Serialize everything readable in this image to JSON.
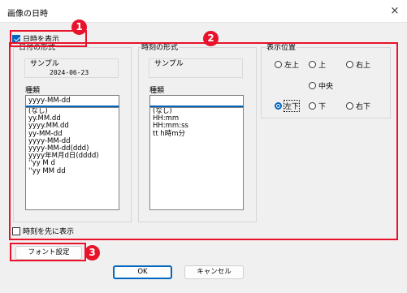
{
  "window": {
    "title": "画像の日時",
    "close_icon": "×"
  },
  "show_datetime": {
    "label": "日時を表示",
    "checked": true
  },
  "date_format": {
    "group_label": "日付の形式",
    "sample_label": "サンプル",
    "sample_value": "2024-06-23",
    "kind_label": "種類",
    "input_value": "yyyy-MM-dd",
    "options": [
      "(なし)",
      "yy.MM.dd",
      "yyyy.MM.dd",
      "yy-MM-dd",
      "yyyy-MM-dd",
      "yyyy-MM-dd(ddd)",
      "yyyy年M月d日(dddd)",
      "''yy M d",
      "''yy MM dd"
    ]
  },
  "time_format": {
    "group_label": "時刻の形式",
    "sample_label": "サンプル",
    "sample_value": "",
    "kind_label": "種類",
    "input_value": "",
    "options": [
      "(なし)",
      "HH:mm",
      "HH:mm:ss",
      "tt h時m分"
    ]
  },
  "position": {
    "group_label": "表示位置",
    "options": [
      "左上",
      "上",
      "右上",
      "中央",
      "左下",
      "下",
      "右下"
    ],
    "selected": "左下"
  },
  "time_first": {
    "label": "時刻を先に表示",
    "checked": false
  },
  "buttons": {
    "font": "フォント設定",
    "ok": "OK",
    "cancel": "キャンセル"
  },
  "badges": [
    "1",
    "2",
    "3"
  ],
  "colors": {
    "accent": "#0067c0",
    "annotation": "#e8132a"
  }
}
